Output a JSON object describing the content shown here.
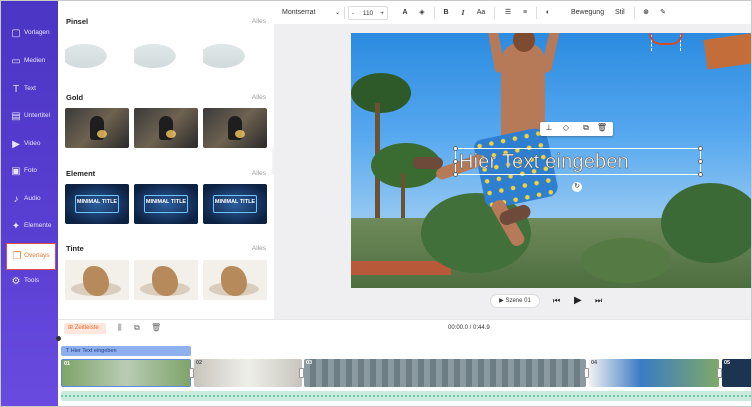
{
  "sidebar": {
    "items": [
      {
        "label": "Vorlagen",
        "icon": "template-icon"
      },
      {
        "label": "Medien",
        "icon": "media-icon"
      },
      {
        "label": "Text",
        "icon": "text-icon"
      },
      {
        "label": "Untertitel",
        "icon": "subtitle-icon"
      },
      {
        "label": "Video",
        "icon": "video-icon"
      },
      {
        "label": "Foto",
        "icon": "photo-icon"
      },
      {
        "label": "Audio",
        "icon": "audio-icon"
      },
      {
        "label": "Elemente",
        "icon": "elements-icon"
      },
      {
        "label": "Overlays",
        "icon": "overlays-icon",
        "active": true
      },
      {
        "label": "Tools",
        "icon": "tools-icon"
      }
    ]
  },
  "panel": {
    "categories": [
      {
        "title": "Pinsel",
        "all": "Alles"
      },
      {
        "title": "Gold",
        "all": "Alles"
      },
      {
        "title": "Element",
        "all": "Alles",
        "thumb_text": "MINIMAL TITLE"
      },
      {
        "title": "Tinte",
        "all": "Alles"
      }
    ]
  },
  "toolbar": {
    "font": "Montserrat",
    "size_minus": "-",
    "size": "110",
    "size_plus": "+",
    "bold": "B",
    "italic": "I",
    "case": "Aa",
    "animation": "Bewegung",
    "style": "Stil"
  },
  "canvas": {
    "text_overlay": "Hier Text eingeben"
  },
  "playback": {
    "scene": "Szene 01"
  },
  "timeline": {
    "label": "Zeitleiste",
    "timecode": "00:00.0 / 0:44.9",
    "text_track": "Hier Text eingeben",
    "clips": [
      "01",
      "02",
      "03",
      "04",
      "05"
    ]
  },
  "colors": {
    "sidebar": "#5a3fd3",
    "accent": "#ea6b33",
    "text_track": "#8fb0ee",
    "audio_track": "#c9eadd"
  }
}
